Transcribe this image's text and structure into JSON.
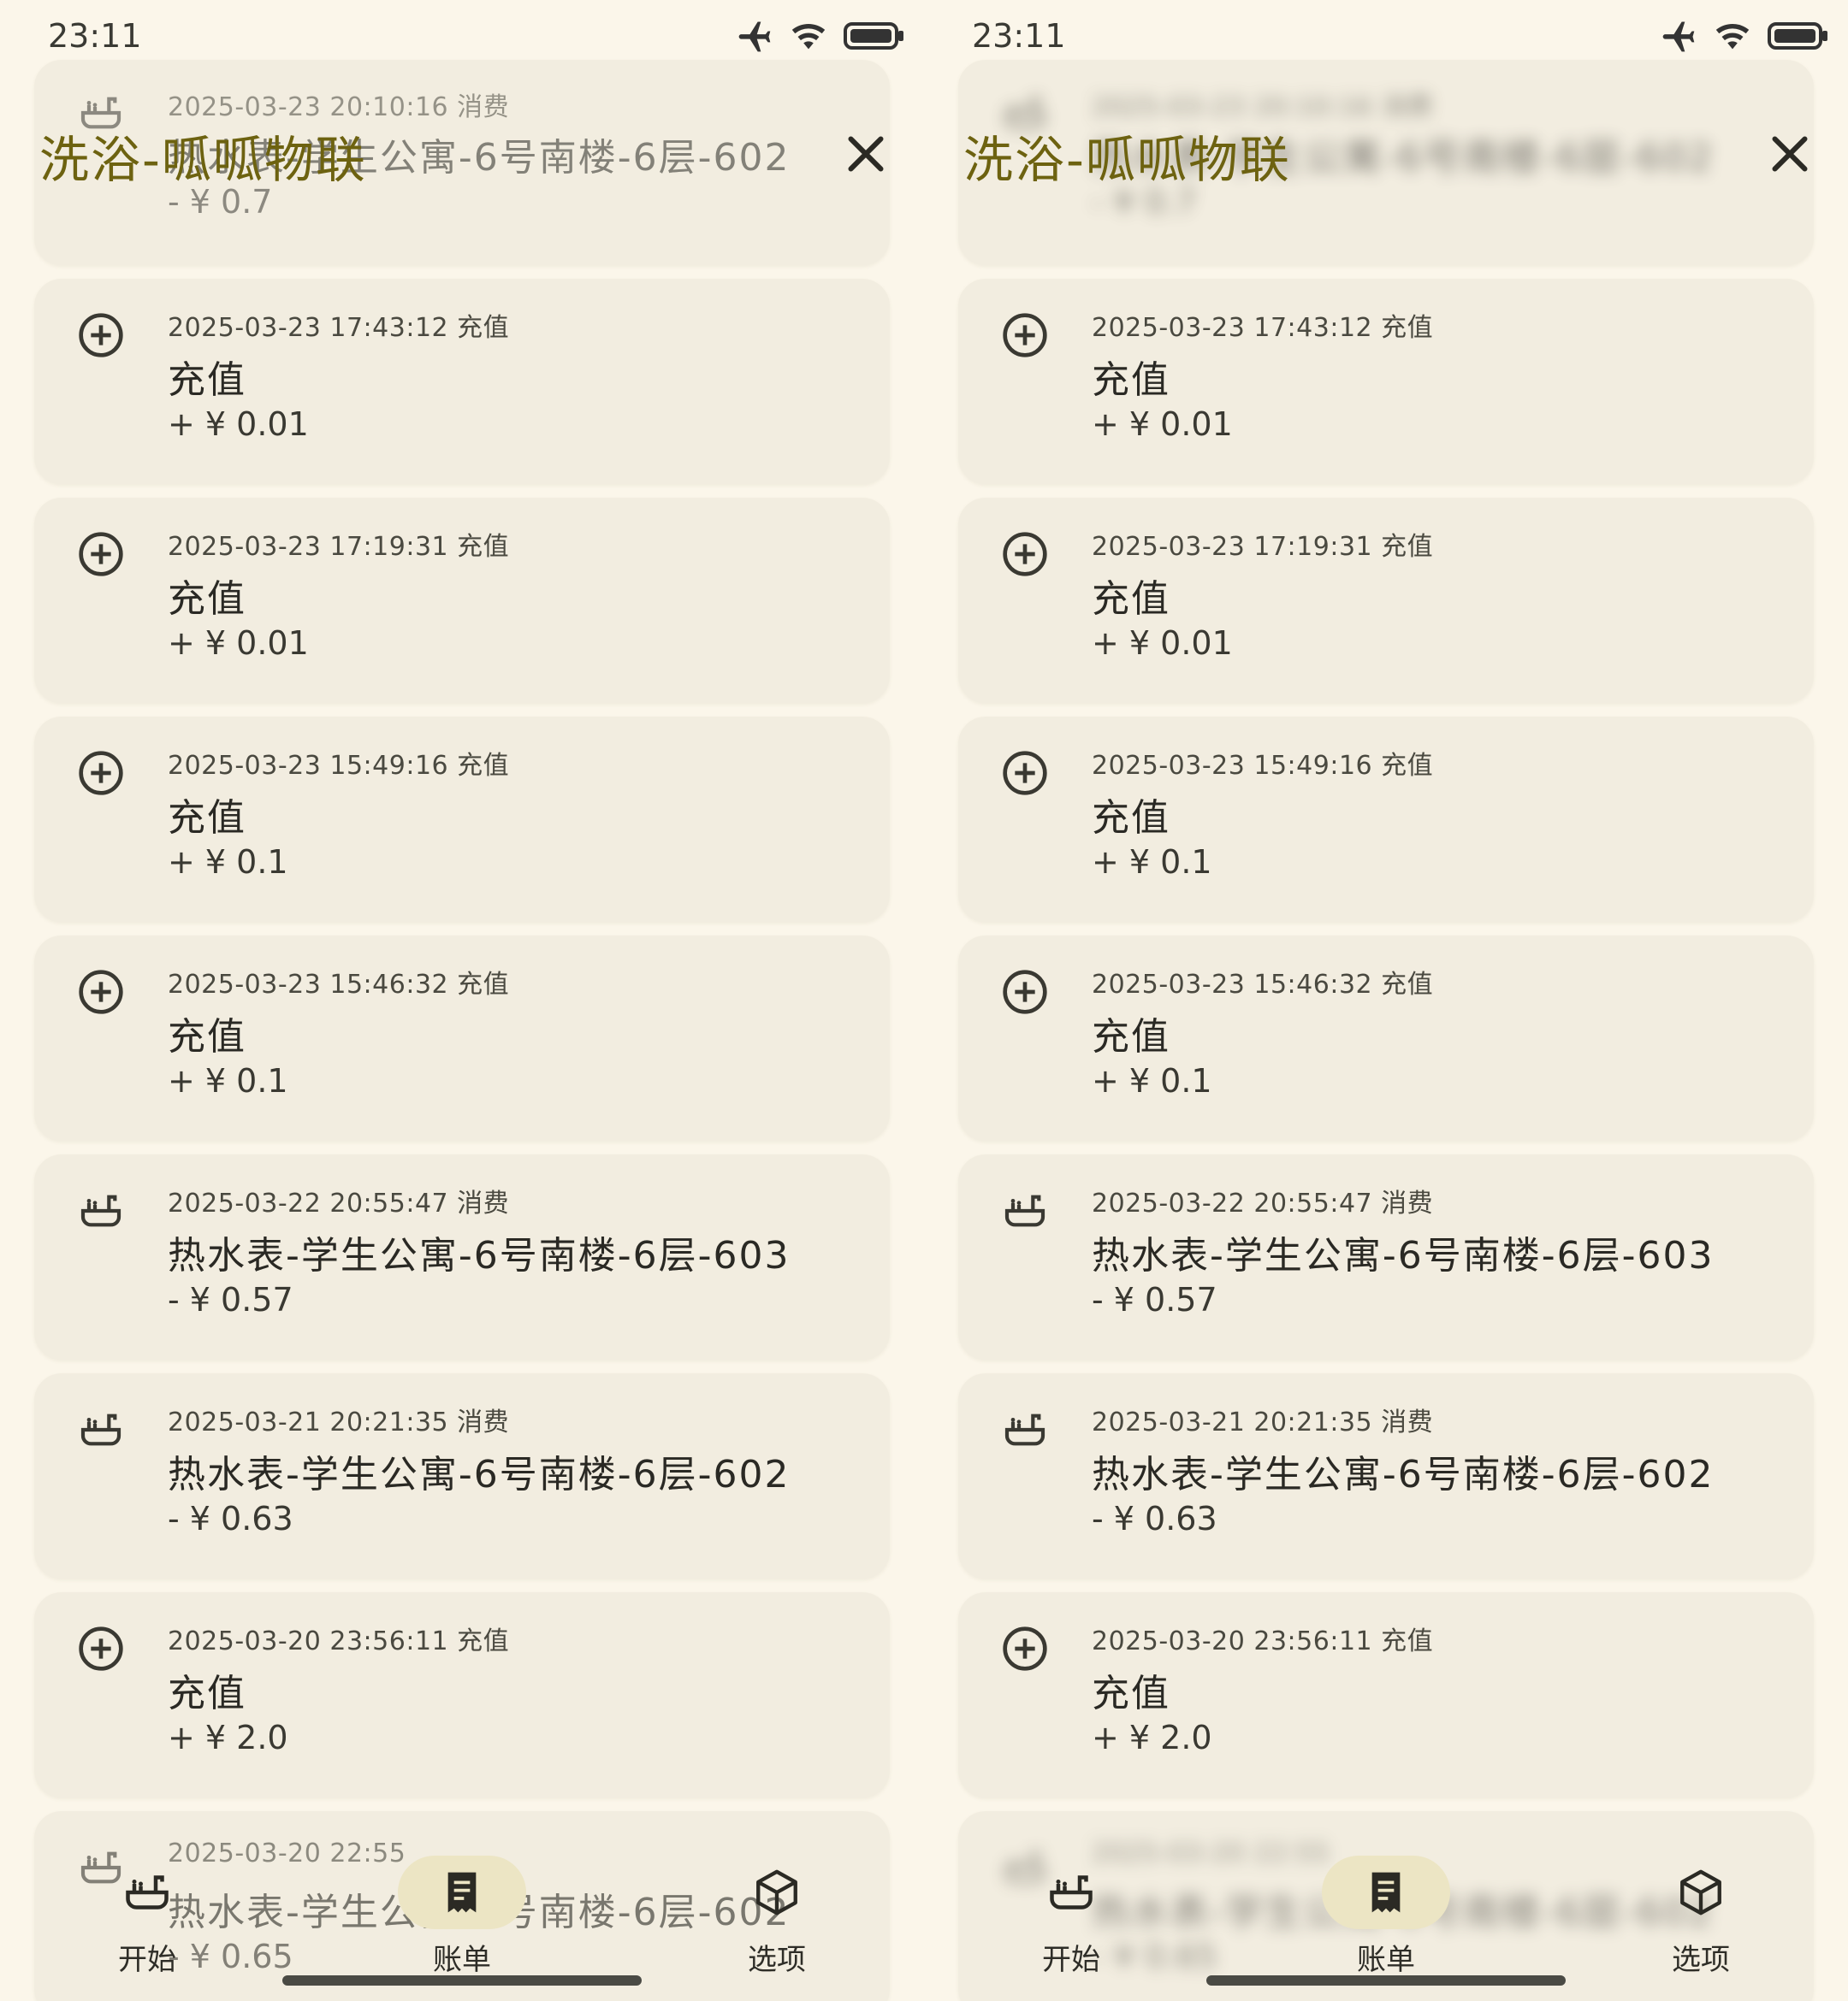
{
  "status": {
    "time": "23:11",
    "icons": [
      "airplane-icon",
      "wifi-icon",
      "battery-icon"
    ]
  },
  "header": {
    "title": "洗浴-呱呱物联",
    "close_icon": "close-icon"
  },
  "records": [
    {
      "icon": "bathtub-icon",
      "meta": "2025-03-23 20:10:16 消费",
      "title": "热水表-学生公寓-6号南楼-6层-602",
      "amount": "- ¥ 0.7"
    },
    {
      "icon": "plus-circle-icon",
      "meta": "2025-03-23 17:43:12 充值",
      "title": "充值",
      "amount": "+ ¥ 0.01"
    },
    {
      "icon": "plus-circle-icon",
      "meta": "2025-03-23 17:19:31 充值",
      "title": "充值",
      "amount": "+ ¥ 0.01"
    },
    {
      "icon": "plus-circle-icon",
      "meta": "2025-03-23 15:49:16 充值",
      "title": "充值",
      "amount": "+ ¥ 0.1"
    },
    {
      "icon": "plus-circle-icon",
      "meta": "2025-03-23 15:46:32 充值",
      "title": "充值",
      "amount": "+ ¥ 0.1"
    },
    {
      "icon": "bathtub-icon",
      "meta": "2025-03-22 20:55:47 消费",
      "title": "热水表-学生公寓-6号南楼-6层-603",
      "amount": "- ¥ 0.57"
    },
    {
      "icon": "bathtub-icon",
      "meta": "2025-03-21 20:21:35 消费",
      "title": "热水表-学生公寓-6号南楼-6层-602",
      "amount": "- ¥ 0.63"
    },
    {
      "icon": "plus-circle-icon",
      "meta": "2025-03-20 23:56:11 充值",
      "title": "充值",
      "amount": "+ ¥ 2.0"
    },
    {
      "icon": "bathtub-icon",
      "meta": "2025-03-20 22:55",
      "title": "热水表-学生公寓-6号南楼-6层-602",
      "amount": "- ¥ 0.65"
    }
  ],
  "nav": {
    "start": {
      "label": "开始",
      "icon": "bathtub-icon"
    },
    "bill": {
      "label": "账单",
      "icon": "receipt-icon"
    },
    "options": {
      "label": "选项",
      "icon": "cube-icon"
    }
  },
  "colors": {
    "background": "#fbf6ea",
    "card": "#f2ede0",
    "title": "#6d6210",
    "nav_active": "#ece5c4"
  }
}
